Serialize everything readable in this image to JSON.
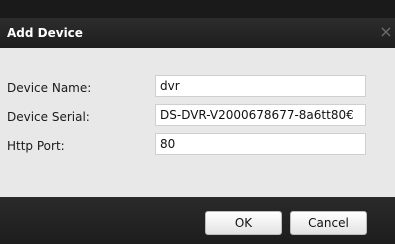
{
  "dialog": {
    "title": "Add Device",
    "close_glyph": "×"
  },
  "form": {
    "device_name": {
      "label": "Device Name:",
      "value": "dvr"
    },
    "device_serial": {
      "label": "Device Serial:",
      "value": "DS-DVR-V2000678677-8a6tt80€"
    },
    "http_port": {
      "label": "Http Port:",
      "value": "80"
    }
  },
  "buttons": {
    "ok": "OK",
    "cancel": "Cancel"
  },
  "icons": {
    "close": "close-icon"
  }
}
